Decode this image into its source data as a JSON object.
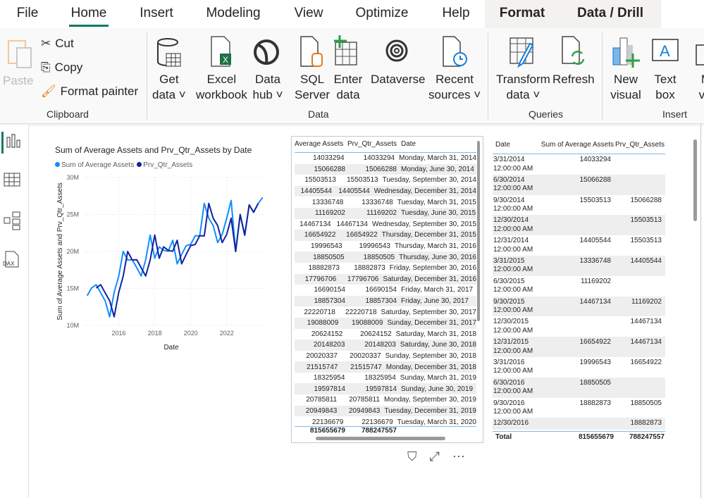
{
  "tabs": [
    {
      "label": "File"
    },
    {
      "label": "Home"
    },
    {
      "label": "Insert"
    },
    {
      "label": "Modeling"
    },
    {
      "label": "View"
    },
    {
      "label": "Optimize"
    },
    {
      "label": "Help"
    },
    {
      "label": "Format"
    },
    {
      "label": "Data / Drill"
    }
  ],
  "ribbon": {
    "clipboard": {
      "label": "Clipboard",
      "paste": "Paste",
      "cut": "Cut",
      "copy": "Copy",
      "format_painter": "Format painter"
    },
    "data": {
      "label": "Data",
      "items": [
        {
          "l1": "Get",
          "l2": "data ˅"
        },
        {
          "l1": "Excel",
          "l2": "workbook"
        },
        {
          "l1": "Data",
          "l2": "hub ˅"
        },
        {
          "l1": "SQL",
          "l2": "Server"
        },
        {
          "l1": "Enter",
          "l2": "data"
        },
        {
          "l1": "Dataverse",
          "l2": ""
        },
        {
          "l1": "Recent",
          "l2": "sources ˅"
        }
      ]
    },
    "queries": {
      "label": "Queries",
      "items": [
        {
          "l1": "Transform",
          "l2": "data ˅"
        },
        {
          "l1": "Refresh",
          "l2": ""
        }
      ]
    },
    "insert": {
      "label": "Insert",
      "items": [
        {
          "l1": "New",
          "l2": "visual"
        },
        {
          "l1": "Text",
          "l2": "box"
        },
        {
          "l1": "M",
          "l2": "vis"
        }
      ]
    }
  },
  "colors": {
    "series1": "#118dff",
    "series2": "#12239e",
    "accent": "#117865"
  },
  "chart_data": {
    "type": "line",
    "title": "Sum of Average Assets and Prv_Qtr_Assets by Date",
    "xlabel": "Date",
    "ylabel": "Sum of Average Assets and Prv_Qtr_Assets",
    "ylim": [
      10000000,
      30000000
    ],
    "yticks": [
      "10M",
      "15M",
      "20M",
      "25M",
      "30M"
    ],
    "xticks": [
      "2016",
      "2018",
      "2020",
      "2022"
    ],
    "grid": true,
    "legend": "top-left",
    "x": [
      "2014-03-31",
      "2014-06-30",
      "2014-09-30",
      "2014-12-31",
      "2015-03-31",
      "2015-06-30",
      "2015-09-30",
      "2015-12-31",
      "2016-03-31",
      "2016-06-30",
      "2016-09-30",
      "2016-12-31",
      "2017-03-31",
      "2017-06-30",
      "2017-09-30",
      "2017-12-31",
      "2018-03-31",
      "2018-06-30",
      "2018-09-30",
      "2018-12-31",
      "2019-03-31",
      "2019-06-30",
      "2019-09-30",
      "2019-12-31",
      "2020-03-31",
      "2020-06-30",
      "2020-09-30",
      "2020-12-31",
      "2021-03-31",
      "2021-06-30",
      "2021-09-30",
      "2021-12-31",
      "2022-03-31",
      "2022-06-30",
      "2022-09-30",
      "2022-12-31",
      "2023-03-31",
      "2023-06-30",
      "2023-09-30",
      "2023-12-31"
    ],
    "series": [
      {
        "name": "Sum of Average Assets",
        "values": [
          14033294,
          15066288,
          15503513,
          14405544,
          13336748,
          11169202,
          14467134,
          16654922,
          19996543,
          18850505,
          18882873,
          17796706,
          16690154,
          18857304,
          22220718,
          19088009,
          20624152,
          20148203,
          20020337,
          21515747,
          18325954,
          19597814,
          20785811,
          20949843,
          22136679,
          22100000,
          26500000,
          24500000,
          23500000,
          21200000,
          22300000,
          24500000,
          26900000,
          20000000,
          25000000,
          22200000,
          26300000,
          25300000,
          26500000,
          27300000
        ]
      },
      {
        "name": "Prv_Qtr_Assets",
        "values": [
          null,
          null,
          15066288,
          15503513,
          14405544,
          13336748,
          11169202,
          14467134,
          16654922,
          19996543,
          18850505,
          18882873,
          17796706,
          16690154,
          18857304,
          22220718,
          19088009,
          20624152,
          20148203,
          20020337,
          21515747,
          18325954,
          19597814,
          20785811,
          20949843,
          22136679,
          22100000,
          26500000,
          24500000,
          23500000,
          21200000,
          22300000,
          24500000,
          20000000,
          25000000,
          22200000,
          26300000,
          25300000,
          26500000
        ]
      }
    ]
  },
  "table1": {
    "headers": [
      "Average Assets",
      "Prv_Qtr_Assets",
      "Date"
    ],
    "rows": [
      [
        "14033294",
        "14033294",
        "Monday, March 31, 2014"
      ],
      [
        "15066288",
        "15066288",
        "Monday, June 30, 2014"
      ],
      [
        "15503513",
        "15503513",
        "Tuesday, September 30, 2014"
      ],
      [
        "14405544",
        "14405544",
        "Wednesday, December 31, 2014"
      ],
      [
        "13336748",
        "13336748",
        "Tuesday, March 31, 2015"
      ],
      [
        "11169202",
        "11169202",
        "Tuesday, June 30, 2015"
      ],
      [
        "14467134",
        "14467134",
        "Wednesday, September 30, 2015"
      ],
      [
        "16654922",
        "16654922",
        "Thursday, December 31, 2015"
      ],
      [
        "19996543",
        "19996543",
        "Thursday, March 31, 2016"
      ],
      [
        "18850505",
        "18850505",
        "Thursday, June 30, 2016"
      ],
      [
        "18882873",
        "18882873",
        "Friday, September 30, 2016"
      ],
      [
        "17796706",
        "17796706",
        "Saturday, December 31, 2016"
      ],
      [
        "16690154",
        "16690154",
        "Friday, March 31, 2017"
      ],
      [
        "18857304",
        "18857304",
        "Friday, June 30, 2017"
      ],
      [
        "22220718",
        "22220718",
        "Saturday, September 30, 2017"
      ],
      [
        "19088009",
        "19088009",
        "Sunday, December 31, 2017"
      ],
      [
        "20624152",
        "20624152",
        "Saturday, March 31, 2018"
      ],
      [
        "20148203",
        "20148203",
        "Saturday, June 30, 2018"
      ],
      [
        "20020337",
        "20020337",
        "Sunday, September 30, 2018"
      ],
      [
        "21515747",
        "21515747",
        "Monday, December 31, 2018"
      ],
      [
        "18325954",
        "18325954",
        "Sunday, March 31, 2019"
      ],
      [
        "19597814",
        "19597814",
        "Sunday, June 30, 2019"
      ],
      [
        "20785811",
        "20785811",
        "Monday, September 30, 2019"
      ],
      [
        "20949843",
        "20949843",
        "Tuesday, December 31, 2019"
      ],
      [
        "22136679",
        "22136679",
        "Tuesday, March 31, 2020"
      ]
    ],
    "total": [
      "815655679",
      "788247557"
    ]
  },
  "table2": {
    "headers": [
      "Date",
      "Sum of Average Assets",
      "Prv_Qtr_Assets"
    ],
    "rows": [
      [
        "3/31/2014",
        "12:00:00 AM",
        "14033294",
        ""
      ],
      [
        "6/30/2014",
        "12:00:00 AM",
        "15066288",
        ""
      ],
      [
        "9/30/2014",
        "12:00:00 AM",
        "15503513",
        "15066288"
      ],
      [
        "12/30/2014",
        "12:00:00 AM",
        "",
        "15503513"
      ],
      [
        "12/31/2014",
        "12:00:00 AM",
        "14405544",
        "15503513"
      ],
      [
        "3/31/2015",
        "12:00:00 AM",
        "13336748",
        "14405544"
      ],
      [
        "6/30/2015",
        "12:00:00 AM",
        "11169202",
        ""
      ],
      [
        "9/30/2015",
        "12:00:00 AM",
        "14467134",
        "11169202"
      ],
      [
        "12/30/2015",
        "12:00:00 AM",
        "",
        "14467134"
      ],
      [
        "12/31/2015",
        "12:00:00 AM",
        "16654922",
        "14467134"
      ],
      [
        "3/31/2016",
        "12:00:00 AM",
        "19996543",
        "16654922"
      ],
      [
        "6/30/2016",
        "12:00:00 AM",
        "18850505",
        ""
      ],
      [
        "9/30/2016",
        "12:00:00 AM",
        "18882873",
        "18850505"
      ],
      [
        "12/30/2016",
        "",
        "",
        "18882873"
      ]
    ],
    "total": [
      "Total",
      "815655679",
      "788247557"
    ]
  }
}
